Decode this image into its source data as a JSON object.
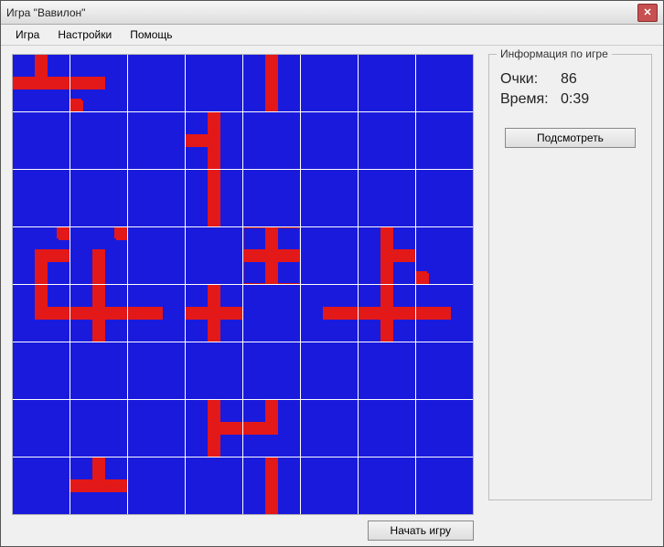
{
  "window": {
    "title": "Игра \"Вавилон\""
  },
  "menu": {
    "game": "Игра",
    "settings": "Настройки",
    "help": "Помощь"
  },
  "info": {
    "legend": "Информация по игре",
    "score_label": "Очки:",
    "score_value": "86",
    "time_label": "Время:",
    "time_value": "0:39",
    "peek_label": "Подсмотреть"
  },
  "buttons": {
    "start": "Начать игру"
  },
  "colors": {
    "tile": "#1a1add",
    "shape": "#e31818",
    "border": "#ffffff"
  },
  "board": {
    "cols": 8,
    "rows": 8,
    "selected": {
      "r": 3,
      "c": 4
    },
    "cells": [
      [
        {
          "n": true,
          "w": true,
          "e": true
        },
        {
          "w": true,
          "sw": true
        },
        {},
        {},
        {
          "n": true,
          "s": true
        },
        {},
        {},
        {}
      ],
      [
        {},
        {},
        {},
        {
          "n": true,
          "w": true,
          "s": true
        },
        {},
        {},
        {},
        {}
      ],
      [
        {},
        {},
        {},
        {
          "n": true,
          "s": true
        },
        {},
        {},
        {},
        {}
      ],
      [
        {
          "s": true,
          "e": true,
          "ne": true
        },
        {
          "ne": true,
          "s": true
        },
        {},
        {},
        {
          "n": true,
          "w": true,
          "e": true,
          "s": true
        },
        {},
        {
          "n": true,
          "s": true,
          "e": true
        },
        {
          "sw": true
        }
      ],
      [
        {
          "n": true,
          "e": true
        },
        {
          "n": true,
          "w": true,
          "e": true,
          "s": true
        },
        {
          "w": true
        },
        {
          "n": true,
          "s": true,
          "w": true,
          "e": true
        },
        {},
        {
          "e": true
        },
        {
          "n": true,
          "s": true,
          "w": true,
          "e": true
        },
        {
          "w": true
        }
      ],
      [
        {},
        {},
        {},
        {},
        {},
        {},
        {},
        {}
      ],
      [
        {},
        {},
        {},
        {
          "n": true,
          "s": true,
          "e": true
        },
        {
          "n": true,
          "w": true
        },
        {},
        {},
        {}
      ],
      [
        {},
        {
          "n": true,
          "w": true,
          "e": true
        },
        {},
        {},
        {
          "n": true,
          "s": true
        },
        {},
        {},
        {}
      ]
    ]
  }
}
